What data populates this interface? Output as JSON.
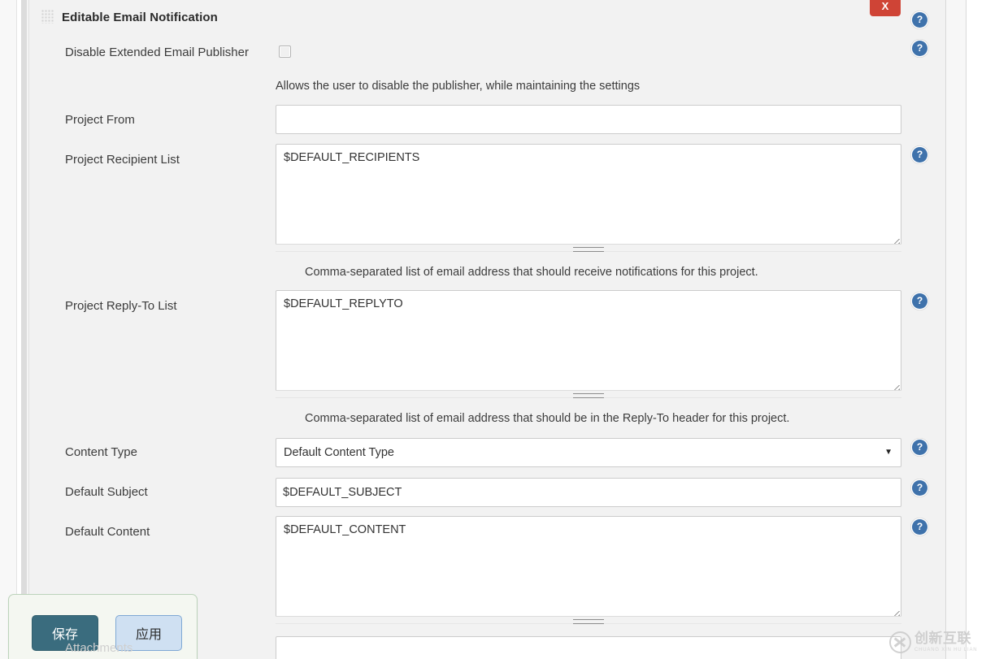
{
  "section": {
    "title": "Editable Email Notification",
    "grip_icon": "drag-grip-icon",
    "close_label": "X"
  },
  "fields": {
    "disable_publisher": {
      "label": "Disable Extended Email Publisher",
      "checked": false,
      "help_text": "Allows the user to disable the publisher, while maintaining the settings"
    },
    "project_from": {
      "label": "Project From",
      "value": ""
    },
    "project_recipient_list": {
      "label": "Project Recipient List",
      "value": "$DEFAULT_RECIPIENTS",
      "help_text": "Comma-separated list of email address that should receive notifications for this project."
    },
    "project_reply_to_list": {
      "label": "Project Reply-To List",
      "value": "$DEFAULT_REPLYTO",
      "help_text": "Comma-separated list of email address that should be in the Reply-To header for this project."
    },
    "content_type": {
      "label": "Content Type",
      "selected": "Default Content Type",
      "arrow_icon": "chevron-down-icon"
    },
    "default_subject": {
      "label": "Default Subject",
      "value": "$DEFAULT_SUBJECT"
    },
    "default_content": {
      "label": "Default Content",
      "value": "$DEFAULT_CONTENT"
    },
    "attachments": {
      "label": "Attachments",
      "value": ""
    }
  },
  "help_icon": {
    "glyph": "?",
    "name": "help-question-icon"
  },
  "save_bar": {
    "save_label": "保存",
    "apply_label": "应用"
  },
  "watermark": {
    "cn": "创新互联",
    "pinyin": "CHUANG XIN HU LIAN"
  },
  "colors": {
    "panel_bg": "#f2f2f2",
    "close_red": "#cf4436",
    "help_blue": "#3f72ab",
    "save_teal": "#3a6c7e",
    "apply_blue": "#cfe0f2",
    "save_bar_bg": "#f4f7f1"
  }
}
